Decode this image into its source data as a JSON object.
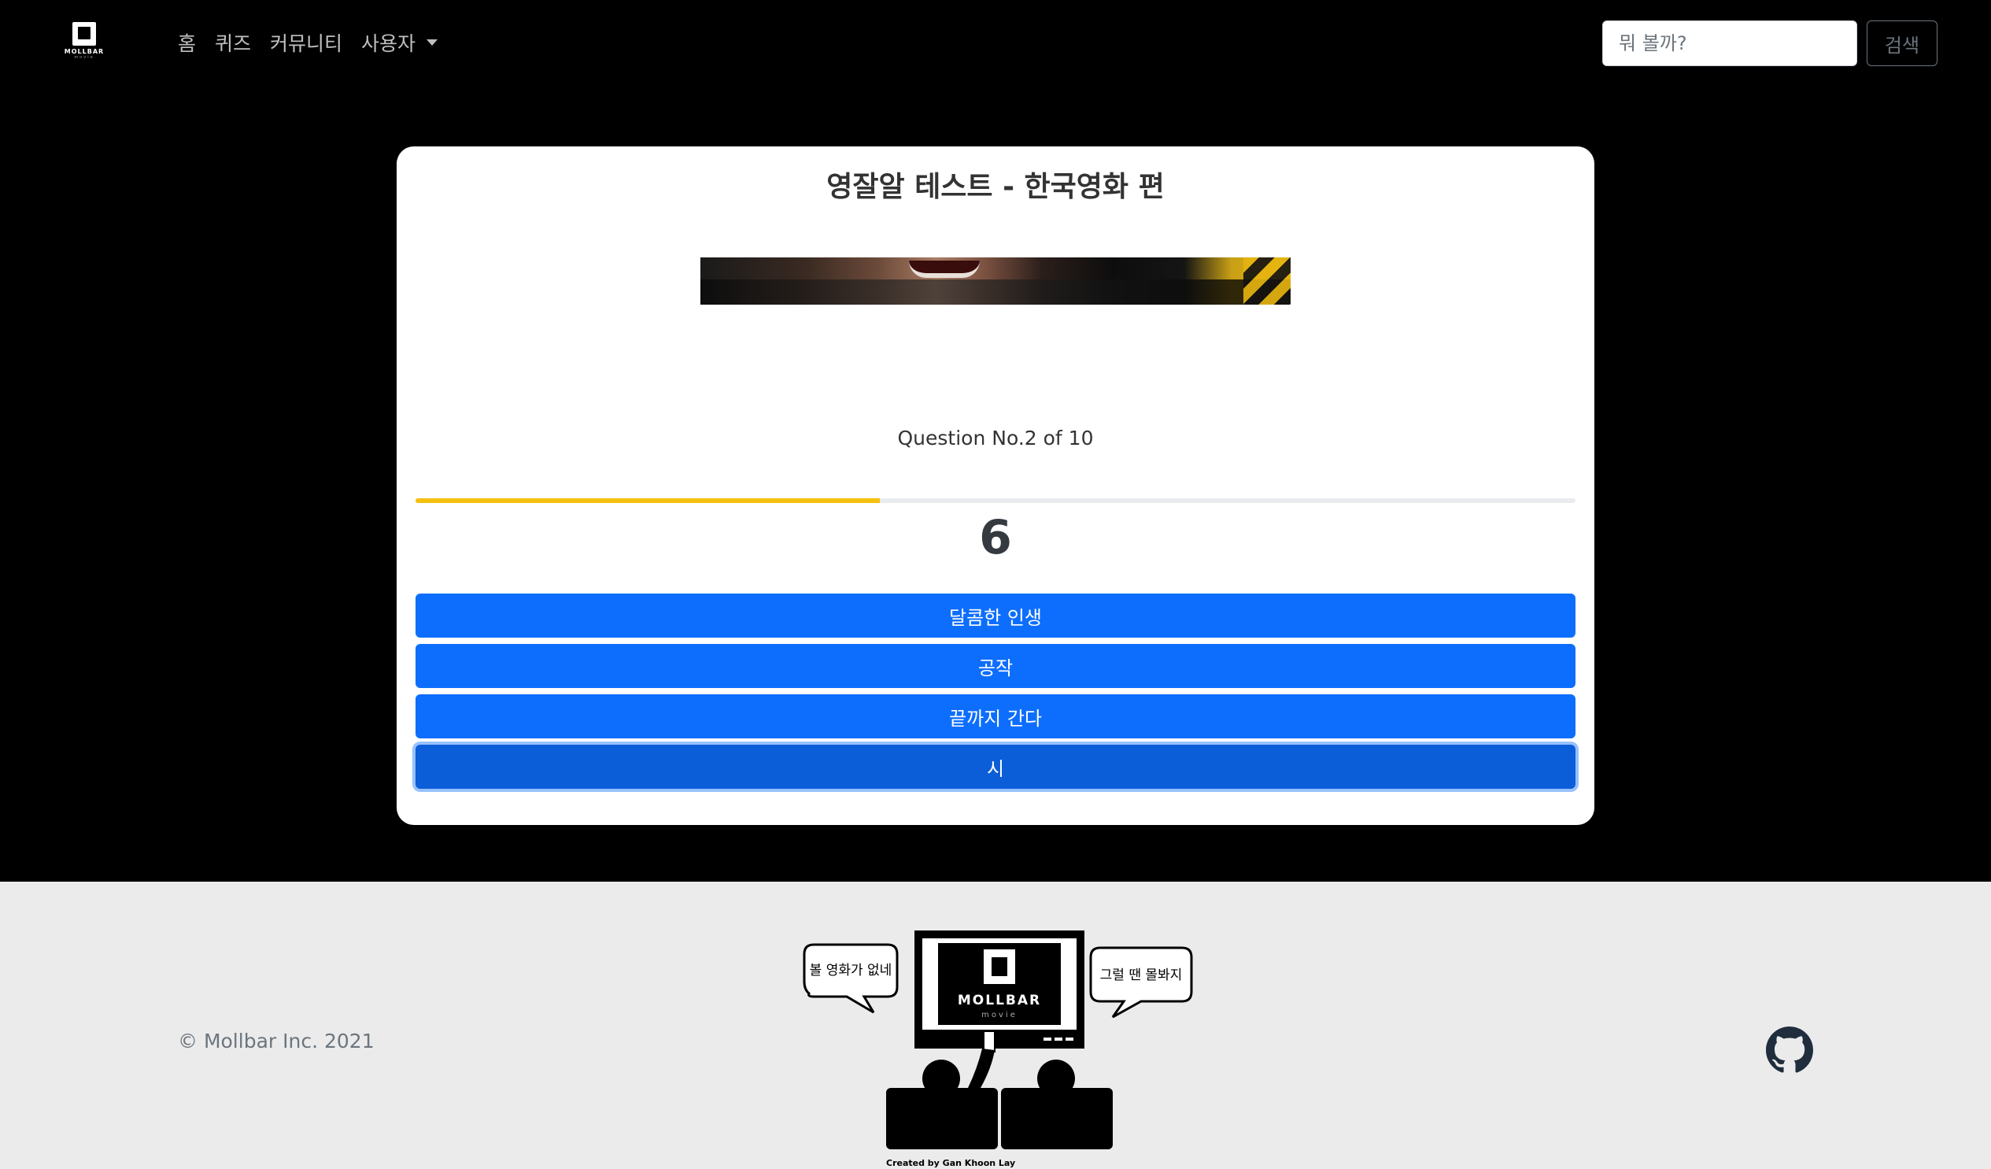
{
  "nav": {
    "brand_text": "MOLLBAR",
    "brand_sub": "movie",
    "links": [
      "홈",
      "퀴즈",
      "커뮤니티",
      "사용자"
    ],
    "search_placeholder": "뭐 볼까?",
    "search_button": "검색"
  },
  "quiz": {
    "title": "영잘알 테스트 - 한국영화 편",
    "question_label": "Question No.2 of 10",
    "progress_percent": 40,
    "countdown": "6",
    "progress_color": "#f5c00f",
    "answers": [
      "달콤한 인생",
      "공작",
      "끝까지 간다",
      "시"
    ],
    "selected_index": 3
  },
  "footer": {
    "copyright": "© Mollbar Inc. 2021",
    "illustration": {
      "left_bubble": "볼 영화가 없네",
      "right_bubble": "그럴 땐 몰봐지",
      "tv_logo": "MOLLBAR",
      "tv_sub": "movie",
      "credit": "Created by Gan Khoon Lay"
    },
    "icon": "github-icon"
  },
  "colors": {
    "primary": "#0d6efd",
    "primary_active": "#0b5ed7",
    "background": "#000000",
    "footer_bg": "#ebebeb"
  }
}
